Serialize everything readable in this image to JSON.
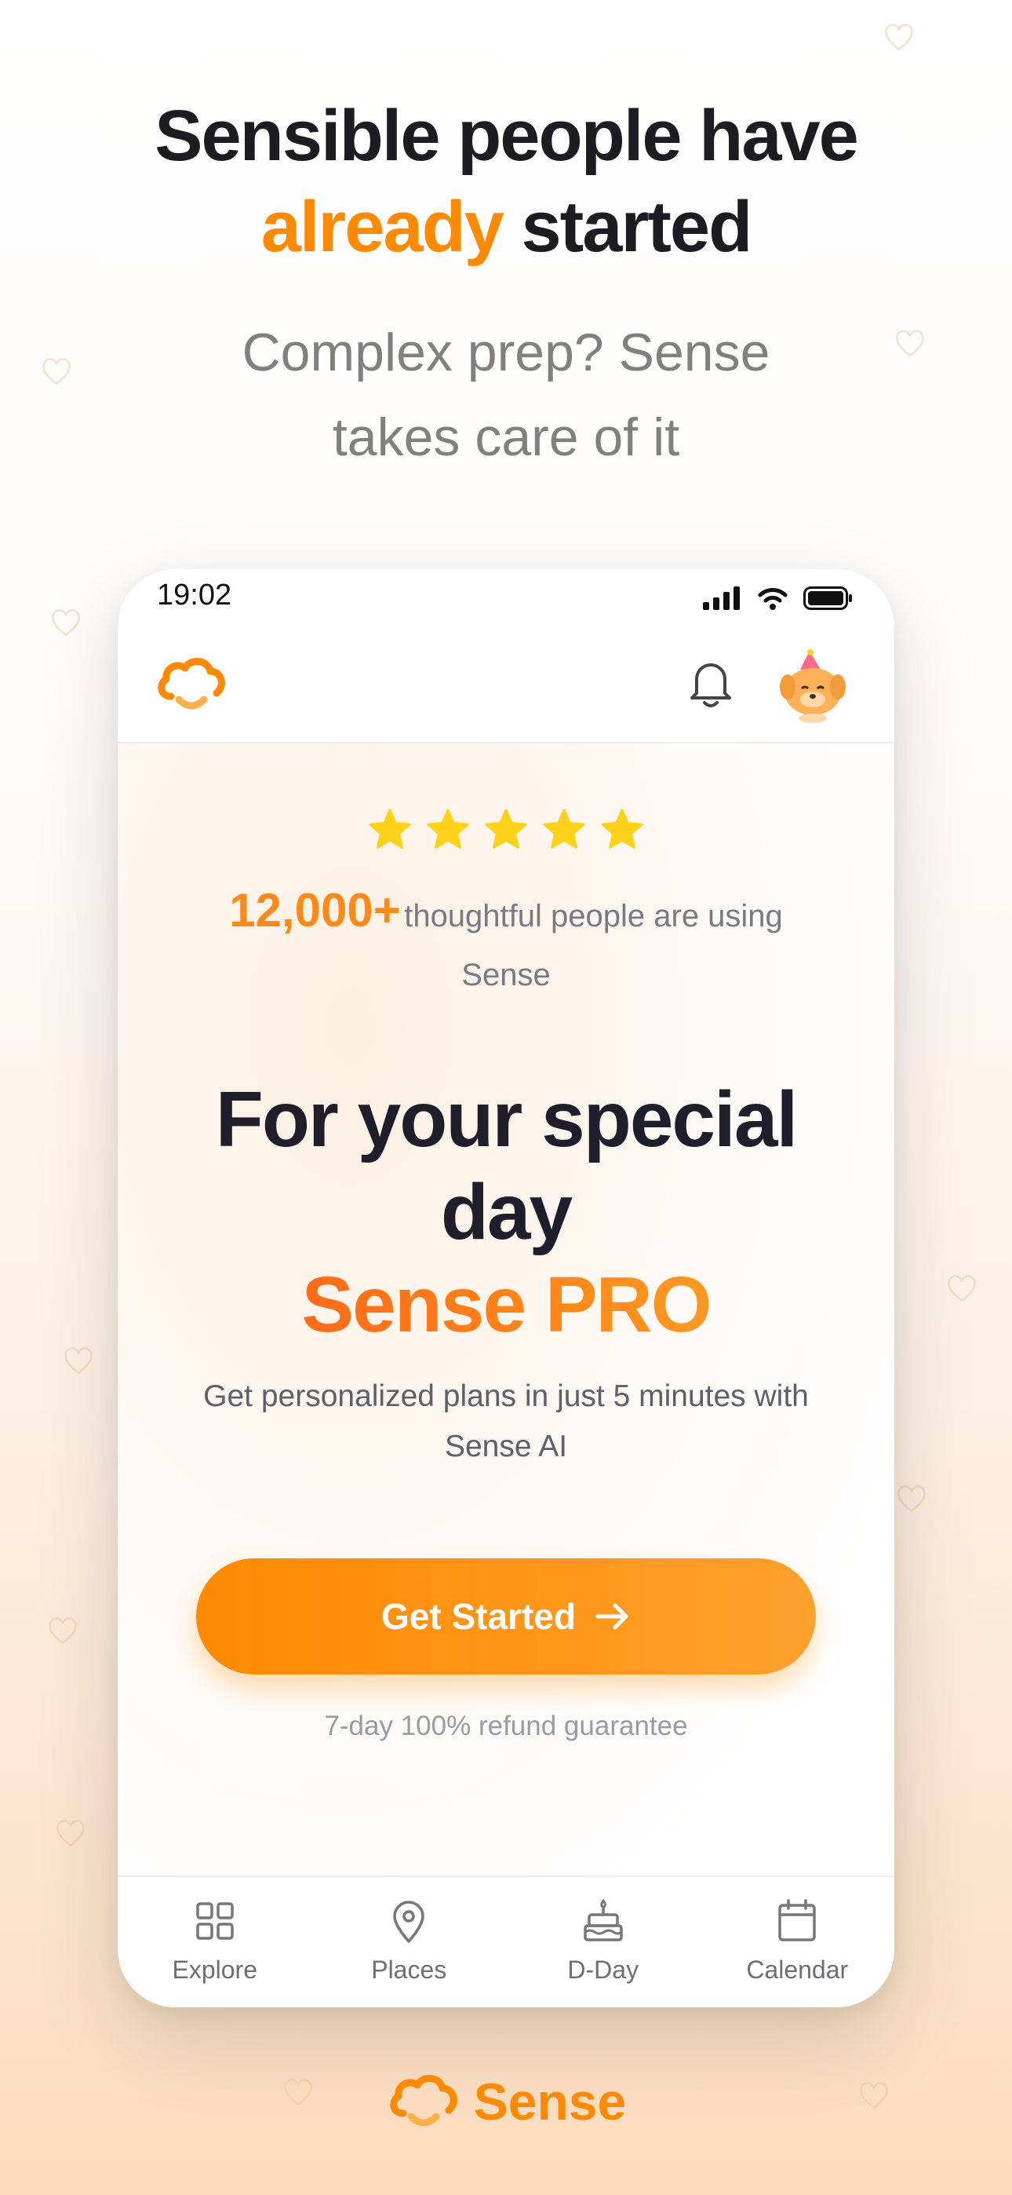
{
  "headline": {
    "line1": "Sensible people have",
    "accent": "already",
    "rest": " started"
  },
  "subhead": {
    "line1": "Complex prep? Sense",
    "line2": "takes care of it"
  },
  "status_bar": {
    "time": "19:02"
  },
  "rating": {
    "stars": 5,
    "count": "12,000+",
    "text": "thoughtful people are using",
    "text2": "Sense"
  },
  "hero": {
    "line1": "For your special",
    "line2": "day",
    "pro": "Sense PRO"
  },
  "description": {
    "line1": "Get personalized plans in just 5 minutes with",
    "line2": "Sense AI"
  },
  "cta": {
    "label": "Get Started"
  },
  "refund_text": "7-day 100% refund guarantee",
  "tabs": [
    {
      "label": "Explore",
      "icon": "grid-icon"
    },
    {
      "label": "Places",
      "icon": "location-pin-icon"
    },
    {
      "label": "D-Day",
      "icon": "cake-icon"
    },
    {
      "label": "Calendar",
      "icon": "calendar-icon"
    }
  ],
  "brand": {
    "name": "Sense"
  },
  "colors": {
    "accent": "#ff8a00",
    "dark": "#1c1c22",
    "star": "#ffd21a"
  }
}
